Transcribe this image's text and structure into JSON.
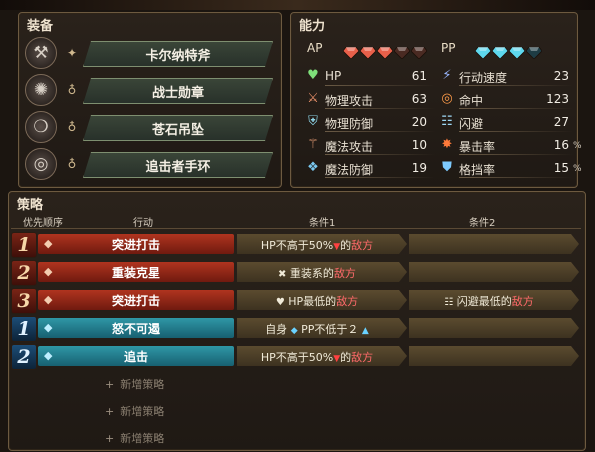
{
  "equipment": {
    "title": "装备",
    "items": [
      {
        "icon": "axe-icon",
        "glyph": "⚒",
        "slot_glyph": "✦",
        "name": "卡尔纳特斧"
      },
      {
        "icon": "medal-icon",
        "glyph": "✺",
        "slot_glyph": "♁",
        "name": "战士勋章"
      },
      {
        "icon": "pendant-icon",
        "glyph": "❍",
        "slot_glyph": "♁",
        "name": "苍石吊坠"
      },
      {
        "icon": "ring-icon",
        "glyph": "◎",
        "slot_glyph": "♁",
        "name": "追击者手环"
      }
    ]
  },
  "stats": {
    "title": "能力",
    "ap_label": "AP",
    "pp_label": "PP",
    "ap_filled": 3,
    "ap_total": 5,
    "pp_filled": 3,
    "pp_total": 4,
    "left": [
      {
        "icon": "heart-icon",
        "glyph": "♥",
        "color": "#7fe07a",
        "name": "HP",
        "value": "61"
      },
      {
        "icon": "sword-icon",
        "glyph": "⚔",
        "color": "#e8906a",
        "name": "物理攻击",
        "value": "63"
      },
      {
        "icon": "armor-icon",
        "glyph": "⛨",
        "color": "#8fd6e8",
        "name": "物理防御",
        "value": "20"
      },
      {
        "icon": "wand-icon",
        "glyph": "⚚",
        "color": "#f1a37a",
        "name": "魔法攻击",
        "value": "10"
      },
      {
        "icon": "magic-shield-icon",
        "glyph": "❖",
        "color": "#79c8f0",
        "name": "魔法防御",
        "value": "19"
      }
    ],
    "right": [
      {
        "icon": "speed-icon",
        "glyph": "⚡",
        "color": "#9ab7ff",
        "name": "行动速度",
        "value": "23",
        "unit": ""
      },
      {
        "icon": "target-icon",
        "glyph": "◎",
        "color": "#ff9c4a",
        "name": "命中",
        "value": "123",
        "unit": ""
      },
      {
        "icon": "evade-icon",
        "glyph": "☷",
        "color": "#9ed8f5",
        "name": "闪避",
        "value": "27",
        "unit": ""
      },
      {
        "icon": "crit-icon",
        "glyph": "✸",
        "color": "#ff7a3a",
        "name": "暴击率",
        "value": "16",
        "unit": "%"
      },
      {
        "icon": "block-icon",
        "glyph": "⛊",
        "color": "#7ecbff",
        "name": "格挡率",
        "value": "15",
        "unit": "%"
      }
    ]
  },
  "tactics": {
    "title": "策略",
    "headers": {
      "priority": "优先顺序",
      "action": "行动",
      "cond1": "条件1",
      "cond2": "条件2"
    },
    "rows": [
      {
        "num": "1",
        "type": "red",
        "action": "突进打击",
        "cond1": {
          "pre": "HP不高于50%",
          "tri": "▼",
          "mid": "的",
          "enemy": "敌方",
          "icon": ""
        },
        "cond2": null
      },
      {
        "num": "2",
        "type": "red",
        "action": "重装克星",
        "cond1": {
          "icon": "✖",
          "pre": " 重装系的",
          "tri": "",
          "mid": "",
          "enemy": "敌方"
        },
        "cond2": null
      },
      {
        "num": "3",
        "type": "red",
        "action": "突进打击",
        "cond1": {
          "icon": "♥",
          "pre": " HP最低的",
          "tri": "",
          "mid": "",
          "enemy": "敌方"
        },
        "cond2": {
          "icon": "☷",
          "pre": " 闪避最低的",
          "enemy": "敌方"
        }
      },
      {
        "num": "1",
        "type": "blue",
        "action": "怒不可遏",
        "cond1": {
          "pre": "自身 ",
          "tri_blue": "◆",
          "mid": " PP不低于２ ",
          "tri2": "▲",
          "enemy": "",
          "icon": ""
        },
        "cond2": null
      },
      {
        "num": "2",
        "type": "blue",
        "action": "追击",
        "cond1": {
          "pre": "HP不高于50%",
          "tri": "▼",
          "mid": "的",
          "enemy": "敌方",
          "icon": ""
        },
        "cond2": null
      }
    ],
    "add_labels": [
      "新增策略",
      "新增策略",
      "新增策略"
    ]
  }
}
